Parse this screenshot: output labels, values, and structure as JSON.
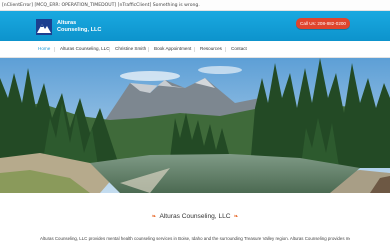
{
  "error_bar": {
    "text": "[nClientError] [MCQ_ERR: OPERATION_TIMEDOUT] [nTrafficClient] Something is wrong."
  },
  "header": {
    "logo_line1": "Alturas",
    "logo_line2": "Counseling, LLC",
    "call_button": "Call Us: 208-882-0200"
  },
  "nav": {
    "items": [
      {
        "label": "Home",
        "active": true
      },
      {
        "label": "Alturas Counseling, LLC"
      },
      {
        "label": "Christine Smith"
      },
      {
        "label": "Book Appointment"
      },
      {
        "label": "Resources"
      },
      {
        "label": "Contact"
      }
    ]
  },
  "main": {
    "tagline": "Alturas Counseling, LLC",
    "intro": "Alturas Counseling, LLC provides mental health counseling services in Boise, Idaho and the surrounding Treasure Valley region. Alturas Counseling provides mental"
  },
  "colors": {
    "header": "#13a0d8",
    "call_button": "#e0452d",
    "nav_active": "#1e9ad8",
    "accent_heart": "#e86b2c"
  }
}
